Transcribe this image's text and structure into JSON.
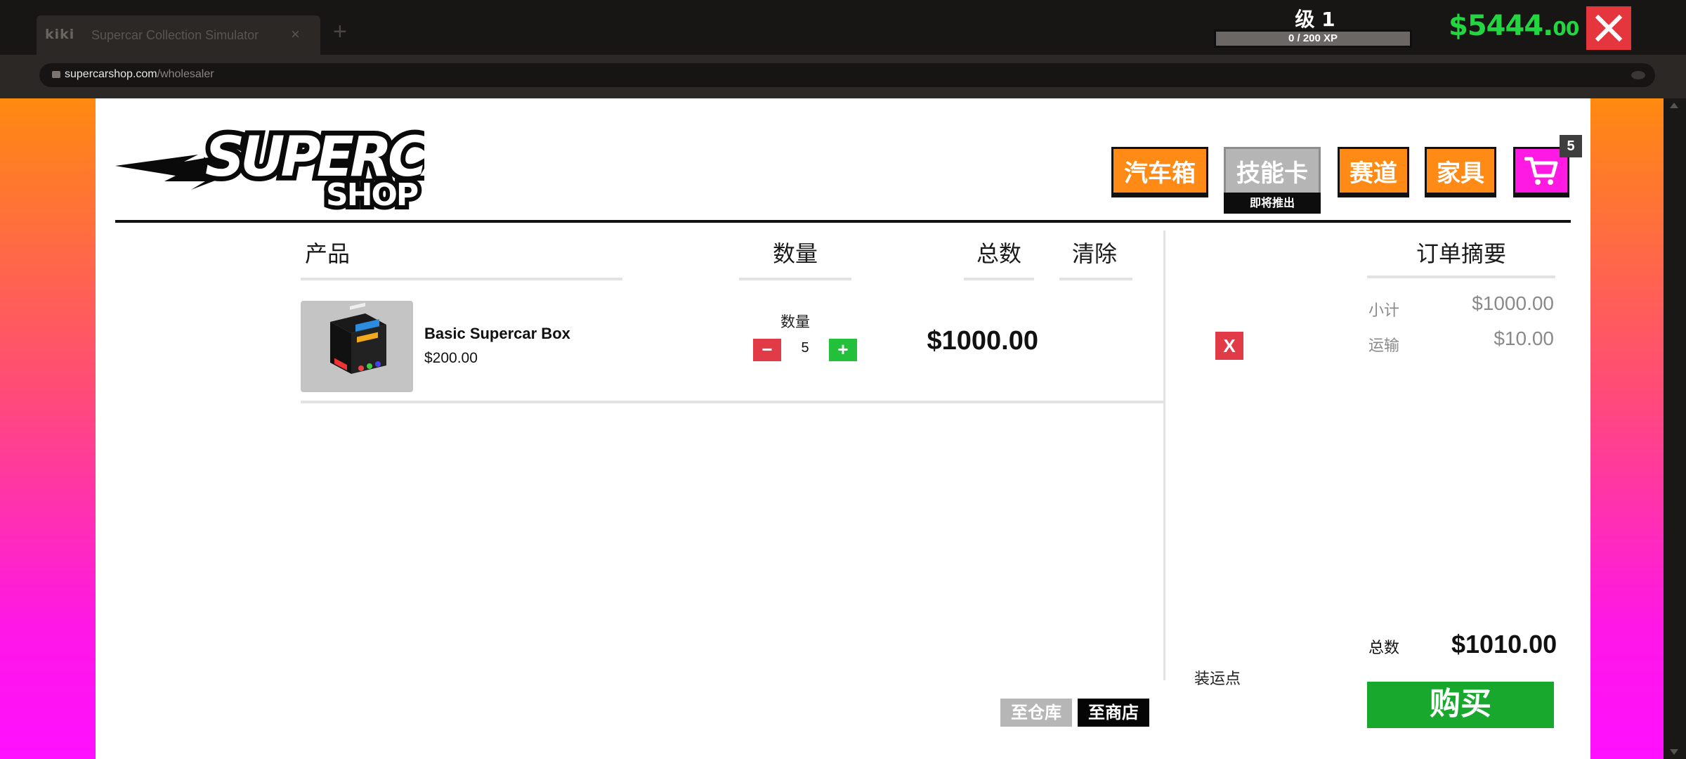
{
  "browser": {
    "tab_logo": "kiki",
    "tab_title": "Supercar Collection Simulator",
    "tab_close": "×",
    "new_tab": "+",
    "url_domain": "supercarshop.com",
    "url_path": "/wholesaler"
  },
  "hud": {
    "level_label": "级 1",
    "xp_text": "0 / 200 XP",
    "xp_progress": 0,
    "money_main": "$5444.",
    "money_cents": "00"
  },
  "shop": {
    "logo_top": "SUPERCAR",
    "logo_bottom": "SHOP",
    "nav": {
      "crates": "汽车箱",
      "cards": "技能卡",
      "cards_soon": "即将推出",
      "track": "赛道",
      "furniture": "家具",
      "cart_count": "5"
    }
  },
  "cart": {
    "headers": {
      "product": "产品",
      "quantity": "数量",
      "total": "总数",
      "clear": "清除"
    },
    "items": [
      {
        "name": "Basic Supercar Box",
        "unit_price": "$200.00",
        "qty_label": "数量",
        "qty_minus": "−",
        "quantity": "5",
        "qty_plus": "+",
        "total": "$1000.00",
        "remove": "X"
      }
    ],
    "shipping": {
      "label": "装运点",
      "to_warehouse": "至仓库",
      "to_store": "至商店"
    }
  },
  "summary": {
    "title": "订单摘要",
    "subtotal_label": "小计",
    "subtotal_value": "$1000.00",
    "shipping_label": "运输",
    "shipping_value": "$10.00",
    "total_label": "总数",
    "total_value": "$1010.00",
    "buy_label": "购买"
  },
  "colors": {
    "orange": "#ff8a15",
    "magenta": "#ff1ae3",
    "money_green": "#22d640",
    "buy_green": "#17a82d",
    "danger_red": "#e23b48"
  }
}
